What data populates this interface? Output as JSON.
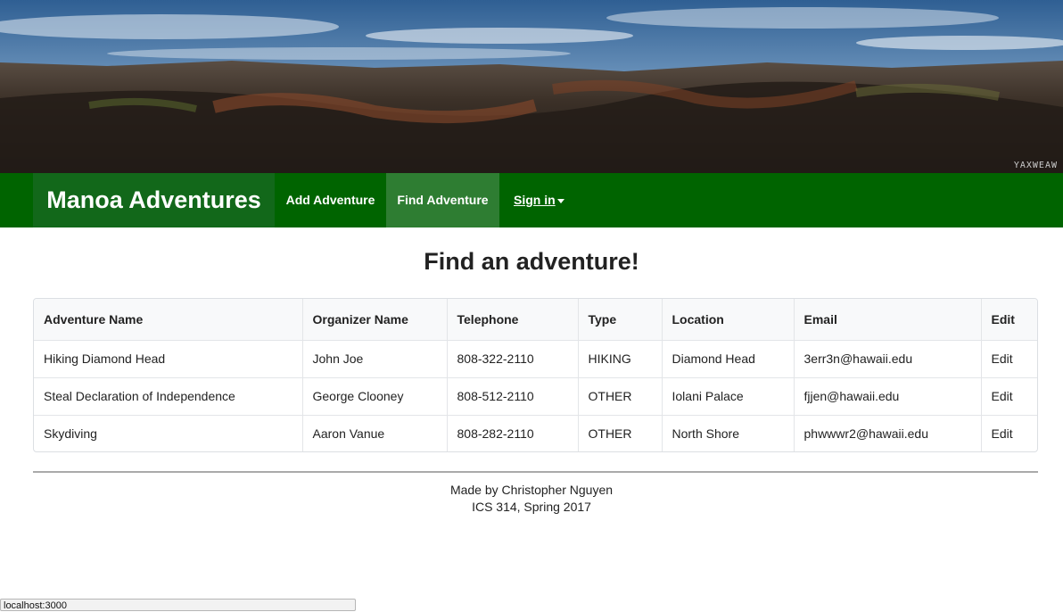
{
  "hero": {
    "watermark": "YAXWEAW"
  },
  "navbar": {
    "brand": "Manoa Adventures",
    "items": [
      {
        "label": "Add Adventure"
      },
      {
        "label": "Find Adventure",
        "active": true
      },
      {
        "label": "Sign in"
      }
    ],
    "color": "#006400"
  },
  "page": {
    "title": "Find an adventure!"
  },
  "table": {
    "columns": [
      "Adventure Name",
      "Organizer Name",
      "Telephone",
      "Type",
      "Location",
      "Email",
      "Edit"
    ],
    "rows": [
      [
        "Hiking Diamond Head",
        "John Joe",
        "808-322-2110",
        "HIKING",
        "Diamond Head",
        "3err3n@hawaii.edu",
        "Edit"
      ],
      [
        "Steal Declaration of Independence",
        "George Clooney",
        "808-512-2110",
        "OTHER",
        "Iolani Palace",
        "fjjen@hawaii.edu",
        "Edit"
      ],
      [
        "Skydiving",
        "Aaron Vanue",
        "808-282-2110",
        "OTHER",
        "North Shore",
        "phwwwr2@hawaii.edu",
        "Edit"
      ]
    ]
  },
  "footer": {
    "line1": "Made by Christopher Nguyen",
    "line2": "ICS 314, Spring 2017"
  },
  "status_bar": {
    "url": "localhost:3000"
  }
}
